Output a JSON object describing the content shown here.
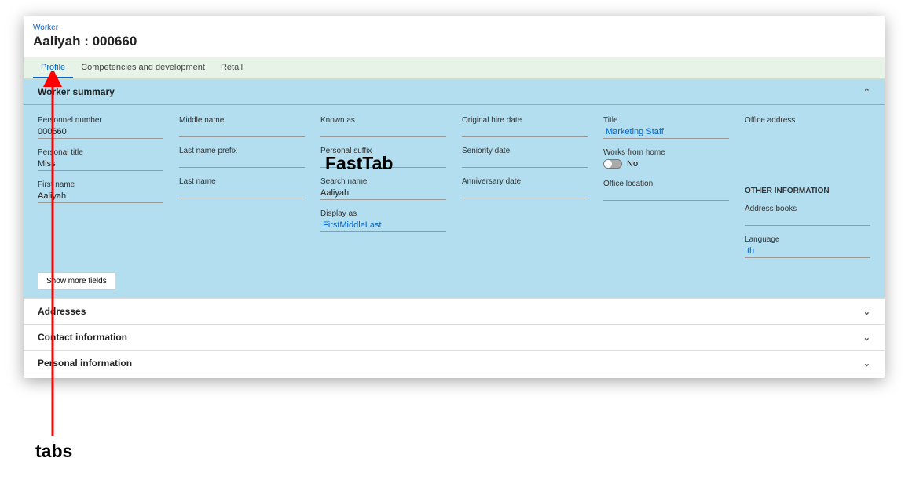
{
  "breadcrumb": "Worker",
  "page_title": "Aaliyah : 000660",
  "tabs": {
    "profile": "Profile",
    "competencies": "Competencies and development",
    "retail": "Retail"
  },
  "fasttabs": {
    "worker_summary": "Worker summary",
    "addresses": "Addresses",
    "contact_information": "Contact information",
    "personal_information": "Personal information"
  },
  "fields": {
    "personnel_number": {
      "label": "Personnel number",
      "value": "000660"
    },
    "personal_title": {
      "label": "Personal title",
      "value": "Miss"
    },
    "first_name": {
      "label": "First name",
      "value": "Aaliyah"
    },
    "middle_name": {
      "label": "Middle name",
      "value": ""
    },
    "last_name_prefix": {
      "label": "Last name prefix",
      "value": ""
    },
    "last_name": {
      "label": "Last name",
      "value": ""
    },
    "known_as": {
      "label": "Known as",
      "value": ""
    },
    "personal_suffix": {
      "label": "Personal suffix",
      "value": ""
    },
    "search_name": {
      "label": "Search name",
      "value": "Aaliyah"
    },
    "display_as": {
      "label": "Display as",
      "value": "FirstMiddleLast"
    },
    "original_hire_date": {
      "label": "Original hire date",
      "value": ""
    },
    "seniority_date": {
      "label": "Seniority date",
      "value": ""
    },
    "anniversary_date": {
      "label": "Anniversary date",
      "value": ""
    },
    "title": {
      "label": "Title",
      "value": "Marketing Staff"
    },
    "works_from_home": {
      "label": "Works from home",
      "value": "No"
    },
    "office_location": {
      "label": "Office location",
      "value": ""
    },
    "office_address": {
      "label": "Office address",
      "value": ""
    },
    "other_information": "OTHER INFORMATION",
    "address_books": {
      "label": "Address books",
      "value": ""
    },
    "language": {
      "label": "Language",
      "value": "th"
    }
  },
  "buttons": {
    "show_more_fields": "Show more fields"
  },
  "annotations": {
    "tabs_label": "tabs",
    "fasttab_label": "FastTab"
  }
}
